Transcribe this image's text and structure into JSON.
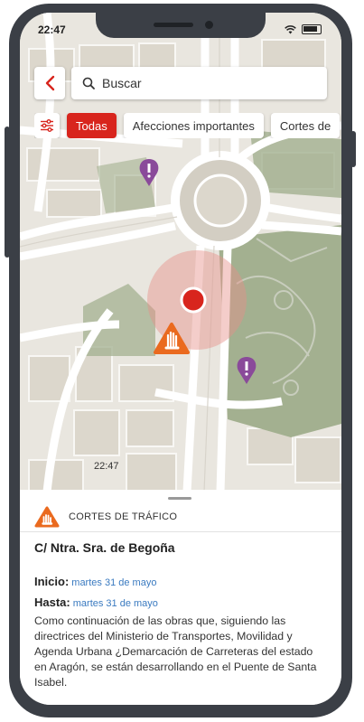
{
  "status": {
    "time": "22:47"
  },
  "map_overlay": {
    "time_echo": "22:47"
  },
  "search": {
    "placeholder": "Buscar"
  },
  "filters": [
    {
      "label": "Todas",
      "active": true
    },
    {
      "label": "Afecciones importantes",
      "active": false
    },
    {
      "label": "Cortes de",
      "active": false
    }
  ],
  "detail": {
    "category": "CORTES DE TRÁFICO",
    "street": "C/ Ntra. Sra. de Begoña",
    "start_label": "Inicio:",
    "start_value": "martes 31 de mayo",
    "end_label": "Hasta:",
    "end_value": "martes 31 de mayo",
    "description": "Como continuación de las obras que, siguiendo las directrices del Ministerio de Transportes, Movilidad y Agenda Urbana ¿Demarcación de Carreteras del estado en Aragón, se están desarrollando en el Puente de Santa Isabel."
  },
  "colors": {
    "accent_red": "#d8251d",
    "warning_orange": "#ea6a1f",
    "poi_purple": "#8a4a9a",
    "link_blue": "#3a7ac0",
    "park_green": "#8e9e7a"
  }
}
